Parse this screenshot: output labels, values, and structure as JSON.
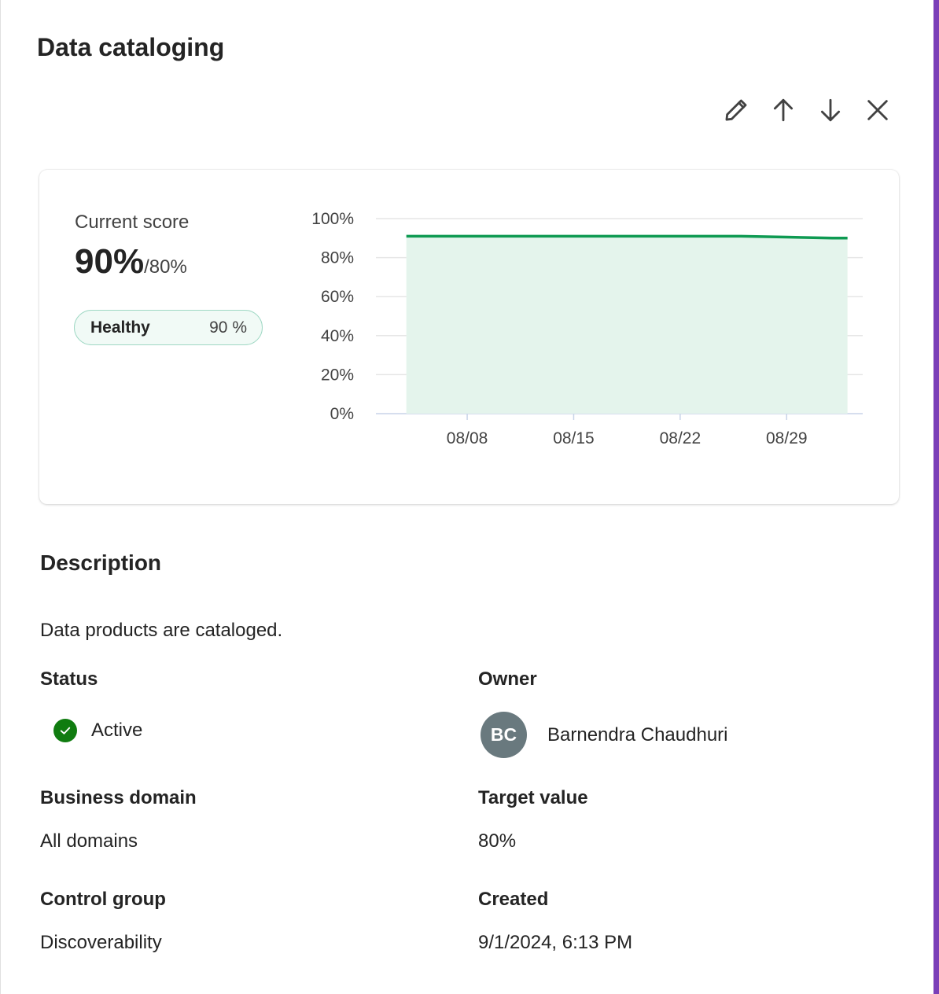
{
  "panel": {
    "title": "Data cataloging",
    "accent_color": "#7b3fb8"
  },
  "toolbar": {
    "edit_icon": "pencil-icon",
    "move_up_icon": "arrow-up-icon",
    "move_down_icon": "arrow-down-icon",
    "close_icon": "close-icon"
  },
  "score_card": {
    "label": "Current score",
    "value": "90%",
    "target": "/80%",
    "health_label": "Healthy",
    "health_value": "90 %",
    "health_color": "#9fd8c4"
  },
  "chart_data": {
    "type": "area",
    "title": "",
    "xlabel": "",
    "ylabel": "",
    "y_ticks": [
      "0%",
      "20%",
      "40%",
      "60%",
      "80%",
      "100%"
    ],
    "x_ticks": [
      "08/08",
      "08/15",
      "08/22",
      "08/29"
    ],
    "ylim": [
      0,
      100
    ],
    "grid": true,
    "line_color": "#0e9a52",
    "fill_color": "#e4f4ec",
    "series": [
      {
        "x": [
          "08/04",
          "08/08",
          "08/15",
          "08/22",
          "08/26",
          "08/29",
          "09/01",
          "09/02"
        ],
        "values": [
          91,
          91,
          91,
          91,
          91,
          90.5,
          90,
          90
        ]
      }
    ]
  },
  "description": {
    "heading": "Description",
    "text": "Data products are cataloged."
  },
  "fields": {
    "status_label": "Status",
    "status_value": "Active",
    "status_color": "#107c10",
    "owner_label": "Owner",
    "owner_initials": "BC",
    "owner_name": "Barnendra Chaudhuri",
    "business_domain_label": "Business domain",
    "business_domain_value": "All domains",
    "target_value_label": "Target value",
    "target_value_value": "80%",
    "control_group_label": "Control group",
    "control_group_value": "Discoverability",
    "created_label": "Created",
    "created_value": "9/1/2024, 6:13 PM"
  }
}
